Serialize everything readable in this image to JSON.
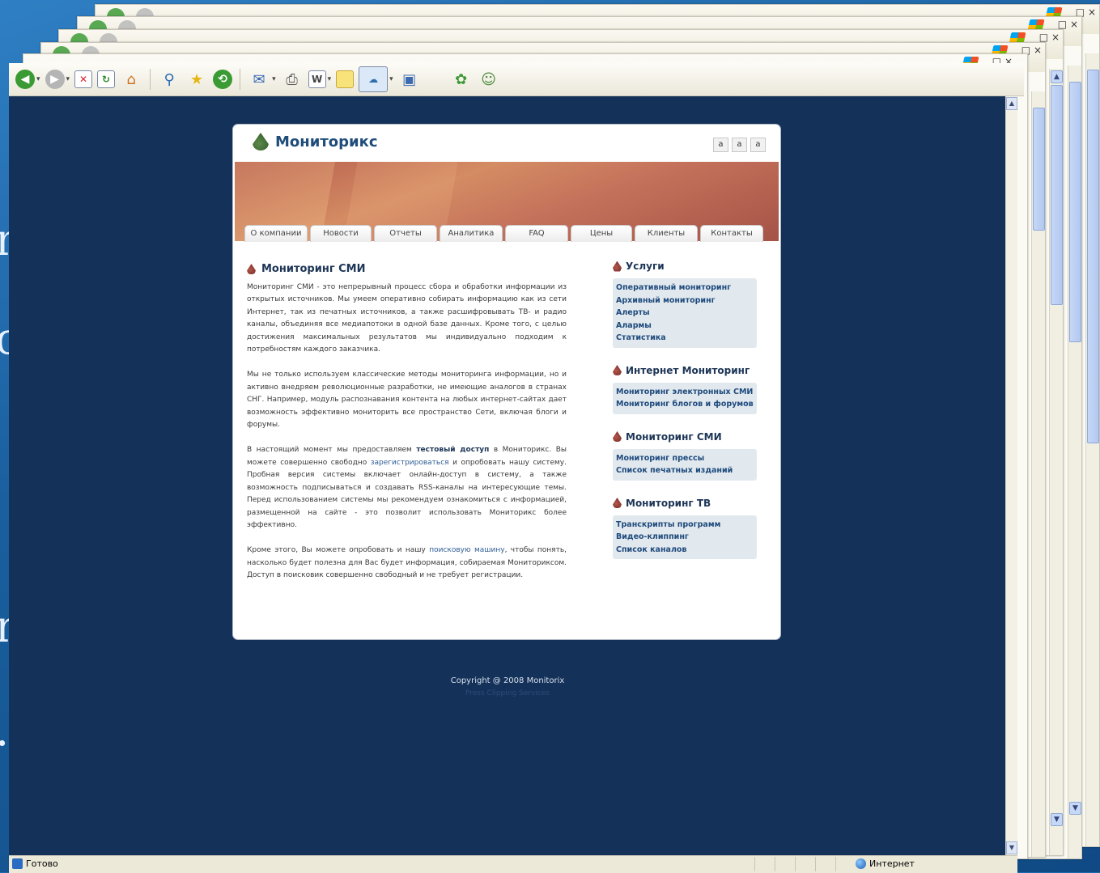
{
  "site": {
    "logo_text": "Мониторикс",
    "font_size_buttons": [
      "a",
      "a",
      "a"
    ],
    "nav_tabs": [
      "О компании",
      "Новости",
      "Отчеты",
      "Аналитика",
      "FAQ",
      "Цены",
      "Клиенты",
      "Контакты"
    ],
    "article": {
      "title": "Мониторинг СМИ",
      "p1": "Мониторинг СМИ - это непрерывный процесс сбора и обработки информации из открытых источников. Мы умеем оперативно собирать информацию как из сети Интернет, так из печатных источников, а также расшифровывать ТВ- и радио каналы, объединяя все медиапотоки в одной базе данных. Кроме того, с целью достижения максимальных результатов мы индивидуально подходим к потребностям каждого заказчика.",
      "p2": "Мы не только используем классические методы мониторинга информации, но и активно внедряем революционные разработки, не имеющие аналогов в странах СНГ. Например, модуль распознавания контента на любых интернет-сайтах дает возможность эффективно мониторить все пространство Сети, включая блоги и форумы.",
      "p3_a": "В настоящий момент мы предоставляем ",
      "p3_link1": "тестовый доступ",
      "p3_b": " в Мониторикс. Вы можете совершенно свободно ",
      "p3_link2": "зарегистрироваться",
      "p3_c": " и опробовать нашу систему. Пробная версия системы включает онлайн-доступ в систему, а также возможность подписываться и создавать RSS-каналы на интересующие темы. Перед использованием системы мы рекомендуем ознакомиться с информацией, размещенной на сайте - это позволит использовать Мониторикс более эффективно.",
      "p4_a": "Кроме этого, Вы можете опробовать и нашу ",
      "p4_link": "поисковую машину",
      "p4_b": ", чтобы понять, насколько будет полезна для Вас будет информация, собираемая Мониториксом. Доступ в поисковик совершенно свободный и не требует регистрации."
    },
    "sidebar": [
      {
        "title": "Услуги",
        "links": [
          "Оперативный мониторинг",
          "Архивный мониторинг",
          "Алерты",
          "Алармы",
          "Статистика"
        ]
      },
      {
        "title": "Интернет Мониторинг",
        "links": [
          "Мониторинг электронных СМИ",
          "Мониторинг блогов и форумов"
        ]
      },
      {
        "title": "Мониторинг СМИ",
        "links": [
          "Мониторинг прессы",
          "Список печатных изданий"
        ]
      },
      {
        "title": "Мониторинг ТВ",
        "links": [
          "Транскрипты программ",
          "Видео-клиппинг",
          "Список каналов"
        ]
      }
    ],
    "footer": {
      "copyright": "Copyright @ 2008 Monitorix",
      "subtitle": "Press Clipping Services"
    }
  },
  "browser": {
    "status_left": "Готово",
    "status_zone": "Интернет",
    "window_controls": [
      "_",
      "□",
      "×"
    ]
  },
  "desktop": {
    "glyphs": [
      "m",
      "c",
      "n",
      "."
    ]
  },
  "colors": {
    "page_bg": "#143159",
    "desktop_bg": "#1c6bb0",
    "link": "#1e4a7d",
    "sidebar_box": "#e2e9ee"
  }
}
